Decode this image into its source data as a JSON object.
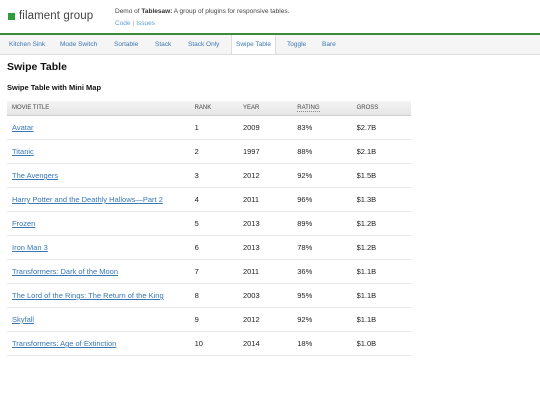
{
  "header": {
    "logo_text": "filament group",
    "demo_prefix": "Demo of ",
    "demo_name": "Tablesaw:",
    "demo_suffix": " A group of plugins for responsive tables.",
    "code_link": "Code",
    "issues_link": "Issues",
    "accent": "#2e9e3a"
  },
  "nav": {
    "items": [
      "Kitchen Sink",
      "Mode Switch",
      "Sortable",
      "Stack",
      "Stack Only",
      "Swipe Table",
      "Toggle",
      "Bare"
    ],
    "active": "Swipe Table"
  },
  "page": {
    "title": "Swipe Table",
    "subtitle": "Swipe Table with Mini Map"
  },
  "table": {
    "columns": [
      "Movie Title",
      "Rank",
      "Year",
      "Rating",
      "Gross"
    ],
    "rows": [
      {
        "title": "Avatar",
        "rank": "1",
        "year": "2009",
        "rating": "83%",
        "gross": "$2.7B"
      },
      {
        "title": "Titanic",
        "rank": "2",
        "year": "1997",
        "rating": "88%",
        "gross": "$2.1B"
      },
      {
        "title": "The Avengers",
        "rank": "3",
        "year": "2012",
        "rating": "92%",
        "gross": "$1.5B"
      },
      {
        "title": "Harry Potter and the Deathly Hallows—Part 2",
        "rank": "4",
        "year": "2011",
        "rating": "96%",
        "gross": "$1.3B"
      },
      {
        "title": "Frozen",
        "rank": "5",
        "year": "2013",
        "rating": "89%",
        "gross": "$1.2B"
      },
      {
        "title": "Iron Man 3",
        "rank": "6",
        "year": "2013",
        "rating": "78%",
        "gross": "$1.2B"
      },
      {
        "title": "Transformers: Dark of the Moon",
        "rank": "7",
        "year": "2011",
        "rating": "36%",
        "gross": "$1.1B"
      },
      {
        "title": "The Lord of the Rings: The Return of the King",
        "rank": "8",
        "year": "2003",
        "rating": "95%",
        "gross": "$1.1B"
      },
      {
        "title": "Skyfall",
        "rank": "9",
        "year": "2012",
        "rating": "92%",
        "gross": "$1.1B"
      },
      {
        "title": "Transformers: Age of Extinction",
        "rank": "10",
        "year": "2014",
        "rating": "18%",
        "gross": "$1.0B"
      }
    ]
  }
}
